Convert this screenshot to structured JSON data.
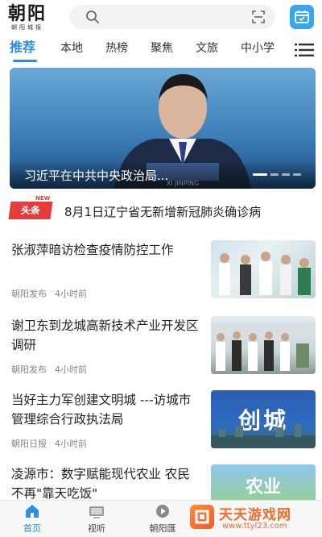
{
  "header": {
    "logo_text": "朝阳",
    "logo_subtext": "朝阳城报",
    "search": {
      "value": "",
      "placeholder": ""
    }
  },
  "tabs": [
    {
      "label": "推荐",
      "active": true
    },
    {
      "label": "本地"
    },
    {
      "label": "热榜"
    },
    {
      "label": "聚焦"
    },
    {
      "label": "文旅"
    },
    {
      "label": "中小学"
    }
  ],
  "banner": {
    "caption": "习近平在中共中央政治局...",
    "slide_count": 4,
    "active_slide": 1
  },
  "headline": {
    "badge": "头条",
    "badge_new": "NEW",
    "text": "8月1日辽宁省无新增新冠肺炎确诊病"
  },
  "news": [
    {
      "title": "张淑萍暗访检查疫情防控工作",
      "source": "朝阳发布",
      "time": "4小时前"
    },
    {
      "title": "谢卫东到龙城高新技术产业开发区调研",
      "source": "朝阳发布",
      "time": "4小时前"
    },
    {
      "title": "当好主力军创建文明城 ---访城市管理综合行政执法局",
      "source": "朝阳日报",
      "time": "4小时前",
      "thumb_text": "创城"
    },
    {
      "title": "凌源市：数字赋能现代农业 农民不再\"靠天吃饭\"",
      "thumb_text": "农业"
    }
  ],
  "bottom_nav": [
    {
      "label": "首页",
      "active": true
    },
    {
      "label": "视听"
    },
    {
      "label": "朝阳匯"
    }
  ],
  "watermark": {
    "title": "天天游戏网",
    "url": "www.ttyl23.com"
  },
  "colors": {
    "accent": "#2a8ee6",
    "badge_red": "#e53b3b",
    "watermark_orange": "#f36b2a"
  }
}
